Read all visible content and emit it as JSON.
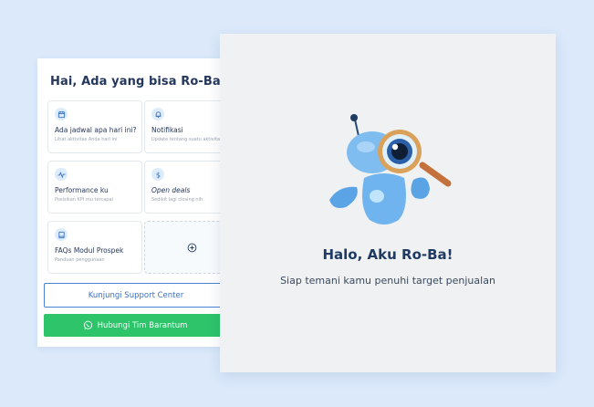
{
  "greeting": "Hai, Ada yang bisa Ro-Ba bantu?",
  "tiles": [
    {
      "icon": "calendar-icon",
      "title": "Ada jadwal apa hari ini?",
      "subtitle": "Lihat aktivitas Anda hari ini"
    },
    {
      "icon": "bell-icon",
      "title": "Notifikasi",
      "subtitle": "Update tentang suatu aktivitas"
    },
    {
      "icon": "activity-icon",
      "title": "Performance ku",
      "subtitle": "Posisikan KPI mu tercapai"
    },
    {
      "icon": "dollar-icon",
      "title": "Open deals",
      "subtitle": "Sedikit lagi closing nih"
    },
    {
      "icon": "book-icon",
      "title": "FAQs Modul Prospek",
      "subtitle": "Panduan penggunaan"
    }
  ],
  "add_tile_icon": "plus-circle-icon",
  "support_button": "Kunjungi Support Center",
  "contact_button": "Hubungi Tim Barantum",
  "hero": {
    "title": "Halo, Aku Ro-Ba!",
    "subtitle": "Siap temani kamu penuhi target penjualan"
  },
  "colors": {
    "page_bg": "#dbe9fb",
    "primary_text": "#24375c",
    "accent_blue": "#4a82d6",
    "green": "#2dc46a",
    "robot_blue": "#7fbdf0"
  }
}
